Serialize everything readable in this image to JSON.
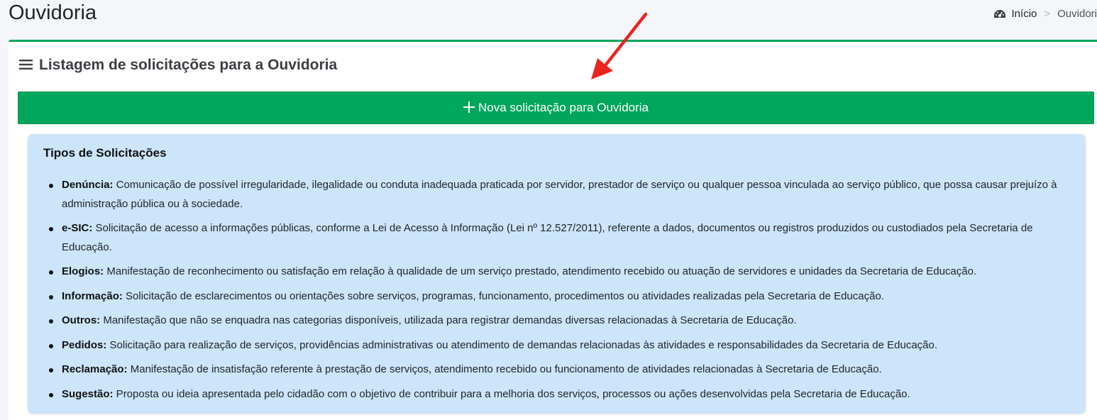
{
  "header": {
    "title": "Ouvidoria",
    "breadcrumb": {
      "home_label": "Início",
      "separator": ">",
      "current_label": "Ouvidori",
      "home_icon": "dashboard-gauge-icon"
    }
  },
  "card": {
    "icon": "bars-icon",
    "title": "Listagem de solicitações para a Ouvidoria",
    "new_button": {
      "icon": "plus-icon",
      "label": "Nova solicitação para Ouvidoria"
    }
  },
  "info": {
    "title": "Tipos de Solicitações",
    "items": [
      {
        "name": "Denúncia:",
        "text": " Comunicação de possível irregularidade, ilegalidade ou conduta inadequada praticada por servidor, prestador de serviço ou qualquer pessoa vinculada ao serviço público, que possa causar prejuízo à administração pública ou à sociedade."
      },
      {
        "name": "e-SIC:",
        "text": " Solicitação de acesso a informações públicas, conforme a Lei de Acesso à Informação (Lei nº 12.527/2011), referente a dados, documentos ou registros produzidos ou custodiados pela Secretaria de Educação."
      },
      {
        "name": "Elogios:",
        "text": " Manifestação de reconhecimento ou satisfação em relação à qualidade de um serviço prestado, atendimento recebido ou atuação de servidores e unidades da Secretaria de Educação."
      },
      {
        "name": "Informação:",
        "text": " Solicitação de esclarecimentos ou orientações sobre serviços, programas, funcionamento, procedimentos ou atividades realizadas pela Secretaria de Educação."
      },
      {
        "name": "Outros:",
        "text": " Manifestação que não se enquadra nas categorias disponíveis, utilizada para registrar demandas diversas relacionadas à Secretaria de Educação."
      },
      {
        "name": "Pedidos:",
        "text": " Solicitação para realização de serviços, providências administrativas ou atendimento de demandas relacionadas às atividades e responsabilidades da Secretaria de Educação."
      },
      {
        "name": "Reclamação:",
        "text": " Manifestação de insatisfação referente à prestação de serviços, atendimento recebido ou funcionamento de atividades relacionadas à Secretaria de Educação."
      },
      {
        "name": "Sugestão:",
        "text": " Proposta ou ideia apresentada pelo cidadão com o objetivo de contribuir para a melhoria dos serviços, processos ou ações desenvolvidas pela Secretaria de Educação."
      }
    ]
  },
  "colors": {
    "accent_green": "#00a65a",
    "info_background": "#cce5fb",
    "annotation_arrow": "#e8261f"
  }
}
